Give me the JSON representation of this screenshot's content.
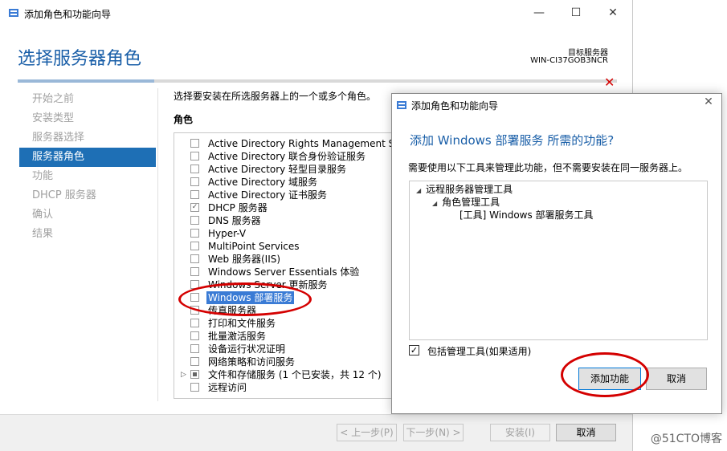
{
  "main_window": {
    "title": "添加角色和功能向导",
    "controls": {
      "minimize": "—",
      "maximize": "☐",
      "close": "✕"
    },
    "heading": "选择服务器角色",
    "destination_label": "目标服务器",
    "destination_server": "WIN-CI37GOB3NCR",
    "sidebar": [
      {
        "label": "开始之前"
      },
      {
        "label": "安装类型"
      },
      {
        "label": "服务器选择"
      },
      {
        "label": "服务器角色",
        "active": true
      },
      {
        "label": "功能"
      },
      {
        "label": "DHCP 服务器"
      },
      {
        "label": "确认"
      },
      {
        "label": "结果"
      }
    ],
    "intro": "选择要安装在所选服务器上的一个或多个角色。",
    "roles_label": "角色",
    "roles": [
      {
        "label": "Active Directory Rights Management Se"
      },
      {
        "label": "Active Directory 联合身份验证服务"
      },
      {
        "label": "Active Directory 轻型目录服务"
      },
      {
        "label": "Active Directory 域服务"
      },
      {
        "label": "Active Directory 证书服务"
      },
      {
        "label": "DHCP 服务器",
        "state": "checked"
      },
      {
        "label": "DNS 服务器"
      },
      {
        "label": "Hyper-V"
      },
      {
        "label": "MultiPoint Services"
      },
      {
        "label": "Web 服务器(IIS)"
      },
      {
        "label": "Windows Server Essentials 体验"
      },
      {
        "label": "Windows Server 更新服务"
      },
      {
        "label": "Windows 部署服务",
        "selected": true
      },
      {
        "label": "传真服务器"
      },
      {
        "label": "打印和文件服务"
      },
      {
        "label": "批量激活服务"
      },
      {
        "label": "设备运行状况证明"
      },
      {
        "label": "网络策略和访问服务"
      },
      {
        "label": "文件和存储服务 (1 个已安装，共 12 个)",
        "state": "partial",
        "expandable": true
      },
      {
        "label": "远程访问"
      }
    ],
    "buttons": {
      "prev": "< 上一步(P)",
      "next": "下一步(N) >",
      "install": "安装(I)",
      "cancel": "取消"
    }
  },
  "dialog": {
    "title": "添加角色和功能向导",
    "close": "✕",
    "heading": "添加 Windows 部署服务 所需的功能?",
    "description": "需要使用以下工具来管理此功能，但不需要安装在同一服务器上。",
    "tree": [
      {
        "label": "远程服务器管理工具",
        "expanded": true
      },
      {
        "label": "角色管理工具",
        "expanded": true
      },
      {
        "label": "[工具] Windows 部署服务工具"
      }
    ],
    "include_tools": {
      "label": "包括管理工具(如果适用)",
      "checked": true
    },
    "buttons": {
      "add": "添加功能",
      "cancel": "取消"
    }
  },
  "watermark": "@51CTO博客",
  "colors": {
    "accent": "#1e6fb5",
    "heading": "#1a5fa8",
    "annotation": "#d40000"
  }
}
